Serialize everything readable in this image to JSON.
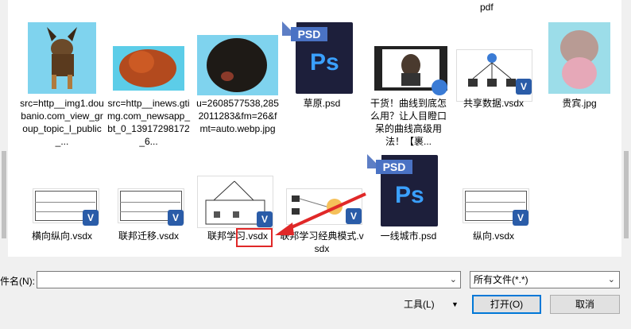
{
  "files_top": [
    "pdf"
  ],
  "files": [
    {
      "name": "src=http__img1.doubanio.com_view_group_topic_l_public_...",
      "type": "image",
      "desc": "german shepherd puppy"
    },
    {
      "name": "src=http__inews.gtimg.com_newsapp_bt_0_13917298172_6...",
      "type": "image",
      "desc": "red tibetan mastiff"
    },
    {
      "name": "u=2608577538,2852011283&fm=26&fmt=auto.webp.jpg",
      "type": "image",
      "desc": "black tibetan mastiff"
    },
    {
      "name": "草原.psd",
      "type": "psd"
    },
    {
      "name": "干货！曲线到底怎么用？让人目瞪口呆的曲线高级用法！【裹...",
      "type": "video"
    },
    {
      "name": "共享数据.vsdx",
      "type": "vsdx"
    },
    {
      "name": "贵宾.jpg",
      "type": "image",
      "desc": "poodle"
    },
    {
      "name": "横向纵向.vsdx",
      "type": "vsdx"
    },
    {
      "name": "联邦迁移.vsdx",
      "type": "vsdx"
    },
    {
      "name": "联邦学习.vsdx",
      "type": "vsdx"
    },
    {
      "name": "联邦学习经典模式.vsdx",
      "type": "vsdx"
    },
    {
      "name": "一线城市.psd",
      "type": "psd"
    },
    {
      "name": "纵向.vsdx",
      "type": "vsdx"
    }
  ],
  "icons": {
    "psd_banner": "PSD",
    "psd_letters": "Ps",
    "visio_badge": "V"
  },
  "footer": {
    "filename_label": "件名(N):",
    "filename_value": "",
    "filetype_value": "所有文件(*.*)",
    "tools_label": "工具(L)",
    "open_label": "打开(O)",
    "cancel_label": "取消"
  },
  "colors": {
    "highlight": "#e02828",
    "accent": "#0078d7",
    "psd_bg": "#1d1f3b",
    "visio_blue": "#2a5ca8"
  }
}
